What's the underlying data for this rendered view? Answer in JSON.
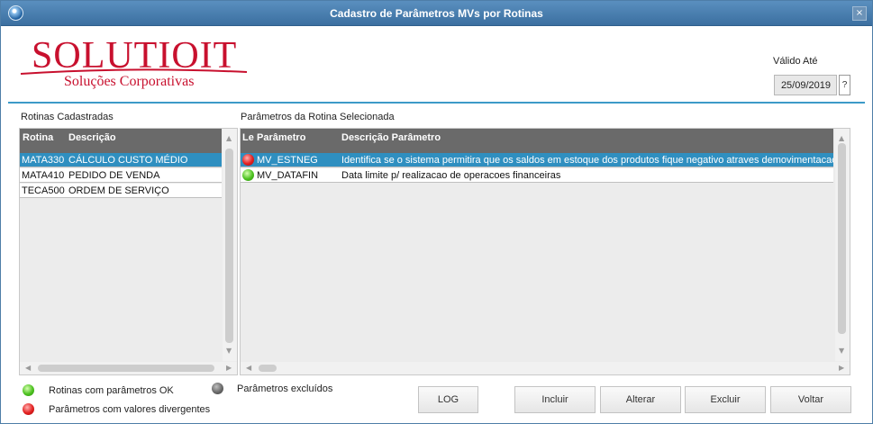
{
  "window": {
    "title": "Cadastro de Parâmetros MVs por Rotinas",
    "close_symbol": "×"
  },
  "logo": {
    "main": "SOLUTIOIT",
    "sub": "Soluções Corporativas"
  },
  "validity": {
    "label": "Válido Até",
    "date": "25/09/2019",
    "help_symbol": "?"
  },
  "rotinas": {
    "title": "Rotinas Cadastradas",
    "columns": [
      "Rotina",
      "Descrição"
    ],
    "rows": [
      {
        "rotina": "MATA330",
        "descricao": "CÁLCULO CUSTO MÉDIO",
        "selected": true
      },
      {
        "rotina": "MATA410",
        "descricao": "PEDIDO DE VENDA",
        "selected": false
      },
      {
        "rotina": "TECA500",
        "descricao": "ORDEM DE SERVIÇO",
        "selected": false
      }
    ]
  },
  "parametros": {
    "title": "Parâmetros da Rotina Selecionada",
    "columns": [
      "Le",
      "Parâmetro",
      "Descrição Parâmetro"
    ],
    "rows": [
      {
        "status": "red",
        "parametro": "MV_ESTNEG",
        "descricao": "Identifica se o sistema permitira que os saldos em estoque dos produtos fique negativo atraves demovimentacao. Con",
        "selected": true
      },
      {
        "status": "green",
        "parametro": "MV_DATAFIN",
        "descricao": "Data limite p/ realizacao de operacoes financeiras",
        "selected": false
      }
    ]
  },
  "legend": {
    "ok": "Rotinas com parâmetros OK",
    "divergent": "Parâmetros com valores divergentes",
    "excluded": "Parâmetros excluídos"
  },
  "buttons": {
    "log": "LOG",
    "incluir": "Incluir",
    "alterar": "Alterar",
    "excluir": "Excluir",
    "voltar": "Voltar"
  },
  "colors": {
    "title_bar": "#3b6fa0",
    "selection": "#2f8fc0",
    "header": "#6a6a6a",
    "brand_red": "#c8102e",
    "rule": "#3c9ac8"
  }
}
